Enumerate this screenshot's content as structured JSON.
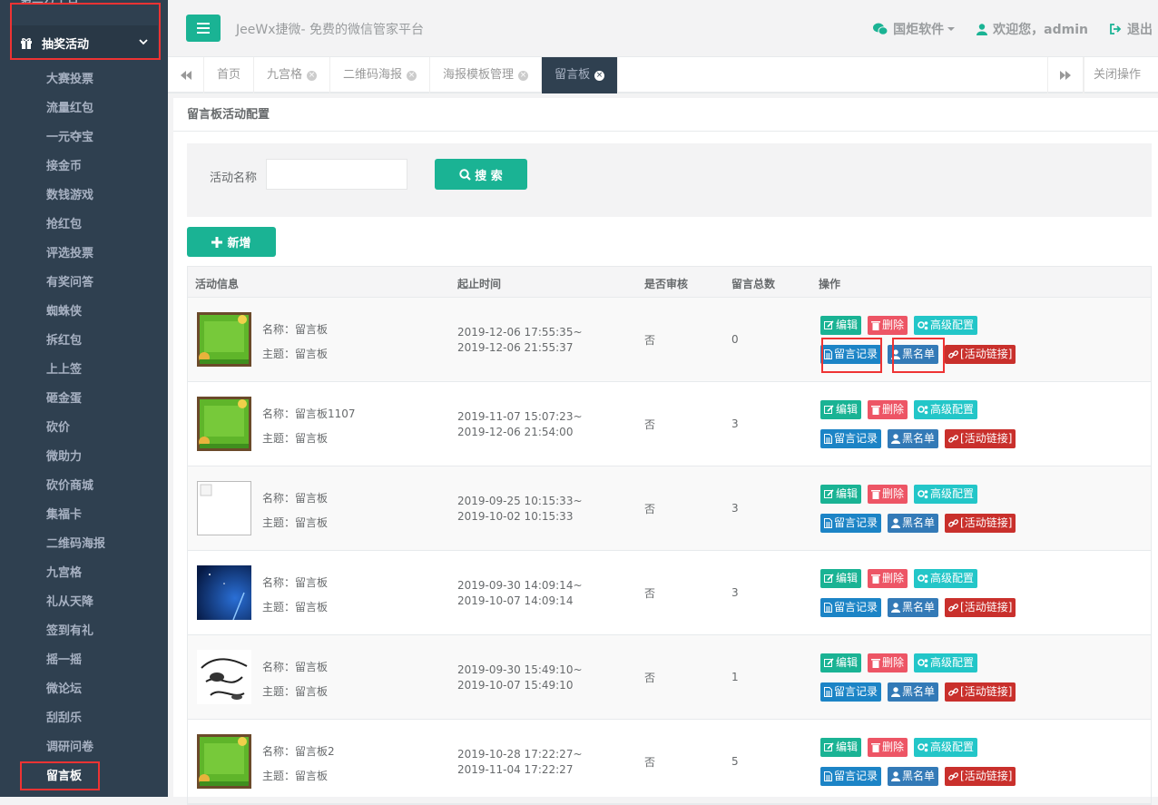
{
  "sidebar": {
    "top_partial": "第三方平台",
    "group": "抽奖活动",
    "items": [
      "大赛投票",
      "流量红包",
      "一元夺宝",
      "接金币",
      "数钱游戏",
      "抢红包",
      "评选投票",
      "有奖问答",
      "蜘蛛侠",
      "拆红包",
      "上上签",
      "砸金蛋",
      "砍价",
      "微助力",
      "砍价商城",
      "集福卡",
      "二维码海报",
      "九宫格",
      "礼从天降",
      "签到有礼",
      "摇一摇",
      "微论坛",
      "刮刮乐",
      "调研问卷",
      "留言板"
    ],
    "active_item": "留言板"
  },
  "header": {
    "brand": "JeeWx捷微- 免费的微信管家平台",
    "company": "国炬软件",
    "welcome": "欢迎您，admin",
    "logout": "退出"
  },
  "tabs": {
    "items": [
      {
        "label": "首页",
        "closable": false
      },
      {
        "label": "九宫格",
        "closable": true
      },
      {
        "label": "二维码海报",
        "closable": true
      },
      {
        "label": "海报模板管理",
        "closable": true
      },
      {
        "label": "留言板",
        "closable": true,
        "active": true
      }
    ],
    "close_ops": "关闭操作"
  },
  "panel": {
    "title": "留言板活动配置",
    "search_label": "活动名称",
    "search_value": "",
    "search_button": "搜 索",
    "add_button": "新增"
  },
  "table": {
    "headers": [
      "活动信息",
      "起止时间",
      "是否审核",
      "留言总数",
      "操作"
    ],
    "rows": [
      {
        "name": "名称：留言板",
        "theme": "主题：留言板",
        "start": "2019-12-06 17:55:35~",
        "end": "2019-12-06 21:55:37",
        "audit": "否",
        "count": "0",
        "thumb": "green"
      },
      {
        "name": "名称：留言板1107",
        "theme": "主题：留言板",
        "start": "2019-11-07 15:07:23~",
        "end": "2019-12-06 21:54:00",
        "audit": "否",
        "count": "3",
        "thumb": "green"
      },
      {
        "name": "名称：留言板",
        "theme": "主题：留言板",
        "start": "2019-09-25 10:15:33~",
        "end": "2019-10-02 10:15:33",
        "audit": "否",
        "count": "3",
        "thumb": "broken"
      },
      {
        "name": "名称：留言板",
        "theme": "主题：留言板",
        "start": "2019-09-30 14:09:14~",
        "end": "2019-10-07 14:09:14",
        "audit": "否",
        "count": "3",
        "thumb": "blue"
      },
      {
        "name": "名称：留言板",
        "theme": "主题：留言板",
        "start": "2019-09-30 15:49:10~",
        "end": "2019-10-07 15:49:10",
        "audit": "否",
        "count": "1",
        "thumb": "sketch"
      },
      {
        "name": "名称：留言板2",
        "theme": "主题：留言板",
        "start": "2019-10-28 17:22:27~",
        "end": "2019-11-04 17:22:27",
        "audit": "否",
        "count": "5",
        "thumb": "green"
      }
    ],
    "ops": {
      "edit": "编辑",
      "del": "删除",
      "adv": "高级配置",
      "rec": "留言记录",
      "blk": "黑名单",
      "link": "[活动链接]"
    }
  },
  "colors": {
    "accent": "#1ab394",
    "sidebar": "#2f4050",
    "danger": "#ed5565",
    "info": "#23c6c8",
    "primary": "#1c84c6",
    "highlight": "#e33333"
  }
}
